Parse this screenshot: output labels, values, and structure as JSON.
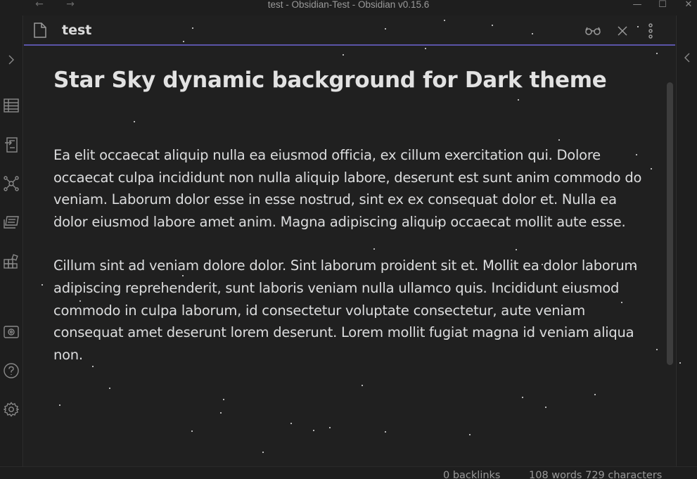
{
  "window": {
    "title": "test - Obsidian-Test - Obsidian v0.15.6",
    "back_icon": "arrow-left-icon",
    "forward_icon": "arrow-right-icon",
    "controls": [
      "minimize-icon",
      "maximize-icon",
      "close-icon"
    ]
  },
  "ribbon": {
    "items": [
      "expand-sidebar-icon",
      "table-icon",
      "import-icon",
      "graph-view-icon",
      "slides-icon",
      "plugins-icon",
      "vault-icon",
      "help-icon",
      "settings-icon"
    ]
  },
  "tab": {
    "title": "test",
    "icon": "file-icon",
    "actions": [
      "reading-view-icon",
      "close-icon",
      "more-options-icon"
    ]
  },
  "document": {
    "heading": "Star Sky dynamic background for Dark theme",
    "paragraphs": [
      "Ea elit occaecat aliquip nulla ea eiusmod officia, ex cillum exercitation qui. Dolore occaecat culpa incididunt non nulla aliquip labore, deserunt est sunt anim commodo do veniam. Laborum dolor esse in esse nostrud, sint ex ex consequat dolor et. Nulla ea dolor eiusmod labore amet anim. Magna adipiscing aliquip occaecat mollit aute esse.",
      "Cillum sint ad veniam dolore dolor. Sint laborum proident sit et. Mollit ea dolor laborum adipiscing reprehenderit, sunt laboris veniam nulla ullamco quis. Incididunt eiusmod commodo in culpa laborum, id consectetur voluptate consectetur, aute veniam consequat amet deserunt lorem deserunt. Lorem mollit fugiat magna id veniam aliqua non."
    ]
  },
  "status": {
    "backlinks": "0 backlinks",
    "counts": "108 words  729 characters"
  },
  "colors": {
    "accent": "#5b54a8",
    "background": "#202020",
    "text": "#dcddde"
  }
}
